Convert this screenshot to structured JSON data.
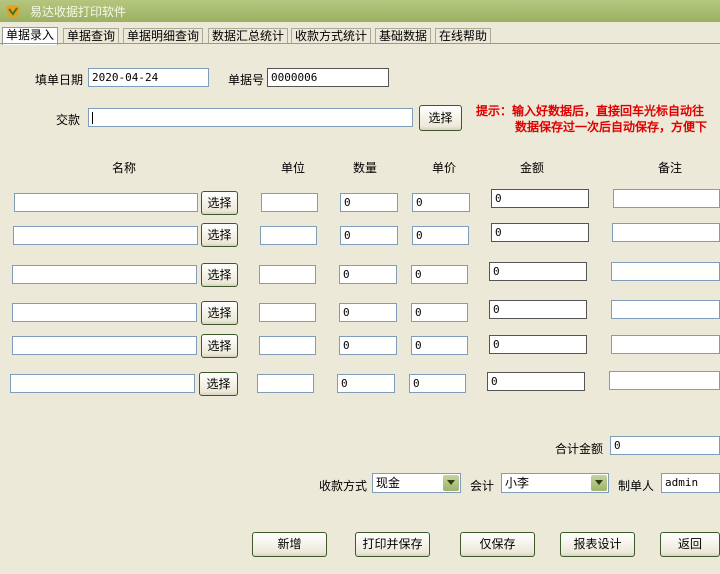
{
  "window": {
    "title": "易达收据打印软件"
  },
  "tabs": [
    "单据录入",
    "单据查询",
    "单据明细查询",
    "数据汇总统计",
    "收款方式统计",
    "基础数据",
    "在线帮助"
  ],
  "header": {
    "date_label": "填单日期",
    "date_value": "2020-04-24",
    "no_label": "单据号",
    "no_value": "0000006",
    "payer_label": "交款",
    "payer_value": "",
    "select_label": "选择"
  },
  "hint": {
    "line1": "提示：输入好数据后，直接回车光标自动往",
    "line2": "数据保存过一次后自动保存，方便下"
  },
  "columns": {
    "name": "名称",
    "unit": "单位",
    "qty": "数量",
    "price": "单价",
    "amount": "金额",
    "note": "备注"
  },
  "rows": [
    {
      "name": "",
      "unit": "",
      "qty": "0",
      "price": "0",
      "amount": "0",
      "note": ""
    },
    {
      "name": "",
      "unit": "",
      "qty": "0",
      "price": "0",
      "amount": "0",
      "note": ""
    },
    {
      "name": "",
      "unit": "",
      "qty": "0",
      "price": "0",
      "amount": "0",
      "note": ""
    },
    {
      "name": "",
      "unit": "",
      "qty": "0",
      "price": "0",
      "amount": "0",
      "note": ""
    },
    {
      "name": "",
      "unit": "",
      "qty": "0",
      "price": "0",
      "amount": "0",
      "note": ""
    },
    {
      "name": "",
      "unit": "",
      "qty": "0",
      "price": "0",
      "amount": "0",
      "note": ""
    }
  ],
  "row_select_label": "选择",
  "total": {
    "label": "合计金额",
    "value": "0"
  },
  "payment": {
    "method_label": "收款方式",
    "method_value": "现金",
    "accountant_label": "会计",
    "accountant_value": "小李",
    "maker_label": "制单人",
    "maker_value": "admin"
  },
  "actions": {
    "new": "新增",
    "print_save": "打印并保存",
    "save_only": "仅保存",
    "report_design": "报表设计",
    "back": "返回"
  }
}
